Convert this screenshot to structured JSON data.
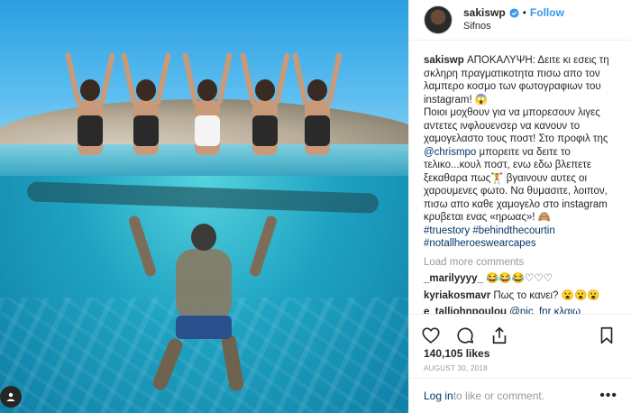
{
  "post": {
    "username": "sakiswp",
    "follow_label": "Follow",
    "location": "Sifnos",
    "separator": "•"
  },
  "caption": {
    "username": "sakiswp",
    "text_1": "ΑΠΟΚΑΛΥΨΗ: Δειτε κι εσεις τη σκληρη πραγματικοτητα πισω απο τον λαμπερο κοσμο των φωτογραφιων του instagram! 😱",
    "text_2": "Ποιοι μοχθουν για να μπορεσουν λιγες αντετες ινφλουενσερ να κανουν το χαμογελαστο τους ποστ! Στο προφιλ της",
    "mention_1": "@chrismpo",
    "text_3": "μπορειτε να δειτε το τελικο...κουλ ποστ, ενω εδω βλεπετε ξεκαθαρα πως🏋 βγαινουν αυτες οι χαρουμενες φωτο. Να θυμασιτε, λοιπον, πισω απο καθε χαμογελο στο instagram κρυβεται ενας «ηρωας»! 🙈",
    "hashtags": "#truestory #behindthecourtin #notallheroeswearcapes"
  },
  "load_more": "Load more comments",
  "comments": [
    {
      "user": "_marilyyyy_",
      "text": "😂😂😂♡♡♡"
    },
    {
      "user": "kyriakosmavr",
      "text": "Πως το κανει? 😮😮😮"
    },
    {
      "user": "e_talljohnpoulou",
      "text": "@nic_fnr κλαιω"
    }
  ],
  "likes": "140,105 likes",
  "date": "AUGUST 30, 2018",
  "login": {
    "link": "Log in",
    "text": " to like or comment.",
    "more": "•••"
  },
  "icons": {
    "like": "heart-icon",
    "comment": "comment-icon",
    "share": "share-icon",
    "save": "bookmark-icon",
    "tag": "user-tag-icon",
    "verified": "verified-badge-icon"
  },
  "colors": {
    "link": "#003569",
    "follow": "#3897f0",
    "muted": "#999999"
  }
}
